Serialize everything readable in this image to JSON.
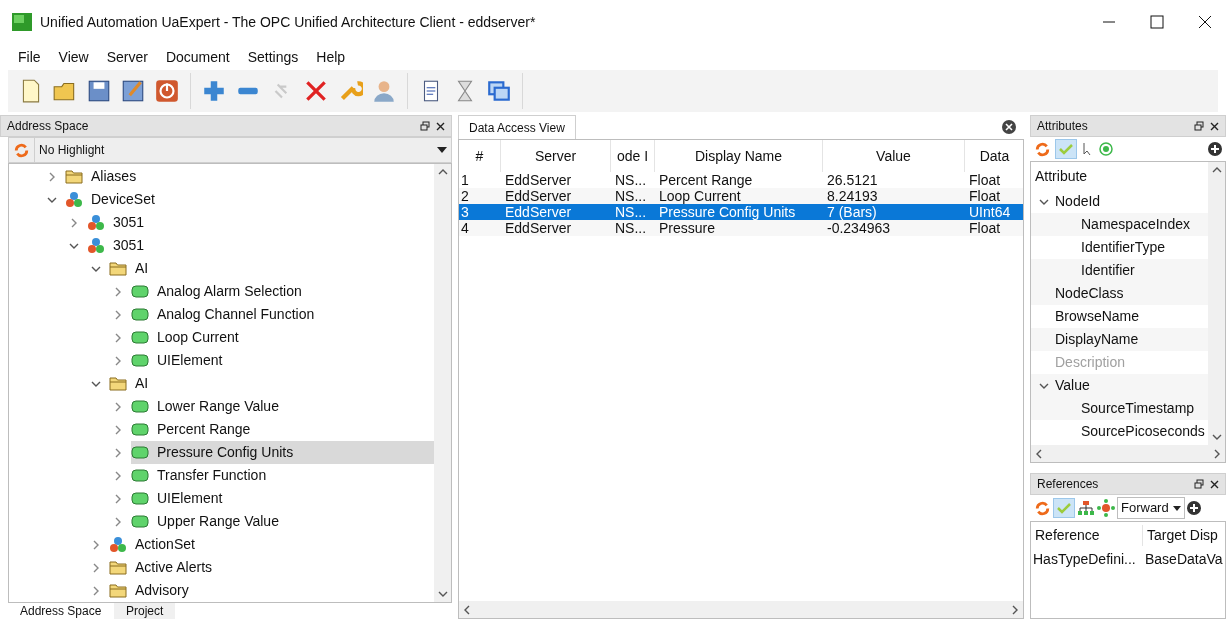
{
  "window": {
    "title": "Unified Automation UaExpert - The OPC Unified Architecture Client - eddserver*"
  },
  "menu": [
    "File",
    "View",
    "Server",
    "Document",
    "Settings",
    "Help"
  ],
  "address_space": {
    "title": "Address Space",
    "highlight": {
      "value": "No Highlight"
    },
    "tree": [
      {
        "label": "Aliases",
        "kind": "folder",
        "expanded": false,
        "selected": false
      },
      {
        "label": "DeviceSet",
        "kind": "object",
        "expanded": true,
        "selected": false,
        "children": [
          {
            "label": "3051",
            "kind": "object",
            "expanded": false,
            "selected": false
          },
          {
            "label": "3051",
            "kind": "object",
            "expanded": true,
            "selected": false,
            "children": [
              {
                "label": "AI",
                "kind": "folder",
                "expanded": true,
                "selected": false,
                "children": [
                  {
                    "label": "Analog Alarm Selection",
                    "kind": "variable",
                    "expanded": false,
                    "selected": false
                  },
                  {
                    "label": "Analog Channel Function",
                    "kind": "variable",
                    "expanded": false,
                    "selected": false
                  },
                  {
                    "label": "Loop Current",
                    "kind": "variable",
                    "expanded": false,
                    "selected": false
                  },
                  {
                    "label": "UIElement",
                    "kind": "variable",
                    "expanded": false,
                    "selected": false
                  }
                ]
              },
              {
                "label": "AI",
                "kind": "folder",
                "expanded": true,
                "selected": false,
                "children": [
                  {
                    "label": "Lower Range Value",
                    "kind": "variable",
                    "expanded": false,
                    "selected": false
                  },
                  {
                    "label": "Percent Range",
                    "kind": "variable",
                    "expanded": false,
                    "selected": false
                  },
                  {
                    "label": "Pressure Config Units",
                    "kind": "variable",
                    "expanded": false,
                    "selected": true
                  },
                  {
                    "label": "Transfer Function",
                    "kind": "variable",
                    "expanded": false,
                    "selected": false
                  },
                  {
                    "label": "UIElement",
                    "kind": "variable",
                    "expanded": false,
                    "selected": false
                  },
                  {
                    "label": "Upper Range Value",
                    "kind": "variable",
                    "expanded": false,
                    "selected": false
                  }
                ]
              },
              {
                "label": "ActionSet",
                "kind": "object",
                "expanded": false,
                "selected": false
              },
              {
                "label": "Active Alerts",
                "kind": "folder",
                "expanded": false,
                "selected": false
              },
              {
                "label": "Advisory",
                "kind": "folder",
                "expanded": false,
                "selected": false
              }
            ]
          }
        ]
      }
    ],
    "tabs": [
      {
        "label": "Address Space",
        "selected": true
      },
      {
        "label": "Project",
        "selected": false
      }
    ]
  },
  "data_access": {
    "tab": "Data Access View",
    "columns": [
      "#",
      "Server",
      "ode I",
      "Display Name",
      "Value",
      "Data"
    ],
    "rows": [
      {
        "cells": [
          "1",
          "EddServer",
          "NS...",
          "Percent Range",
          "26.5121",
          "Float"
        ],
        "selected": false
      },
      {
        "cells": [
          "2",
          "EddServer",
          "NS...",
          "Loop Current",
          "8.24193",
          "Float"
        ],
        "selected": false
      },
      {
        "cells": [
          "3",
          "EddServer",
          "NS...",
          "Pressure Config Units",
          "7 (Bars)",
          "UInt64"
        ],
        "selected": true
      },
      {
        "cells": [
          "4",
          "EddServer",
          "NS...",
          "Pressure",
          "-0.234963",
          "Float"
        ],
        "selected": false
      }
    ]
  },
  "attributes": {
    "title": "Attributes",
    "header": "Attribute",
    "items": [
      {
        "label": "NodeId",
        "expanded": true,
        "disabled": false,
        "children": [
          {
            "label": "NamespaceIndex",
            "disabled": false
          },
          {
            "label": "IdentifierType",
            "disabled": false
          },
          {
            "label": "Identifier",
            "disabled": false
          }
        ]
      },
      {
        "label": "NodeClass",
        "disabled": false
      },
      {
        "label": "BrowseName",
        "disabled": false
      },
      {
        "label": "DisplayName",
        "disabled": false
      },
      {
        "label": "Description",
        "disabled": true
      },
      {
        "label": "Value",
        "expanded": true,
        "disabled": false,
        "children": [
          {
            "label": "SourceTimestamp",
            "disabled": false
          },
          {
            "label": "SourcePicoseconds",
            "disabled": false
          }
        ]
      }
    ]
  },
  "references": {
    "title": "References",
    "direction": "Forward",
    "columns": [
      "Reference",
      "Target Disp"
    ],
    "rows": [
      [
        "HasTypeDefini...",
        "BaseDataVa"
      ]
    ]
  }
}
